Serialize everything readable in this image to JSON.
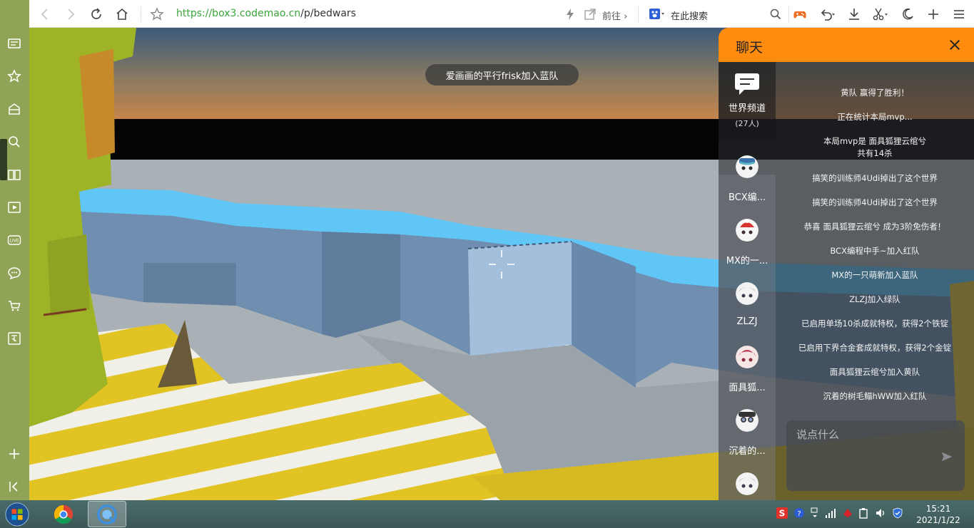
{
  "browser": {
    "url_host": "https://box3.codemao.cn",
    "url_path": "/p/bedwars",
    "goto_label": "前往",
    "search_label": "在此搜索"
  },
  "game": {
    "toast": "爱画画的平行frisk加入蓝队"
  },
  "chat": {
    "title": "聊天",
    "channels": [
      {
        "name": "世界频道",
        "count": "(27人)"
      },
      {
        "name": "BCX编..."
      },
      {
        "name": "MX的一..."
      },
      {
        "name": "ZLZJ"
      },
      {
        "name": "面具狐..."
      },
      {
        "name": "沉着的..."
      }
    ],
    "messages": [
      "黄队 赢得了胜利！",
      "正在统计本局mvp...",
      "本局mvp是 面具狐狸云绾兮",
      "共有14杀",
      "搞笑的训练师4Udi掉出了这个世界",
      "搞笑的训练师4Udi掉出了这个世界",
      "恭喜 面具狐狸云绾兮 成为3阶免伤者！",
      "BCX编程中手~加入红队",
      "MX的一只萌新加入蓝队",
      "ZLZJ加入绿队",
      "已启用单场10杀成就特权，获得2个铁锭",
      "已启用下界合金套成就特权，获得2个金锭",
      "面具狐狸云绾兮加入黄队",
      "沉着的树毛鳎hWW加入红队"
    ],
    "input_placeholder": "说点什么"
  },
  "taskbar": {
    "time": "15:21",
    "date": "2021/1/22"
  },
  "colors": {
    "chat_header": "#ff8c0f",
    "sidebar": "#8fa456",
    "water": "#5fc6f6",
    "block": "#6f8eb0",
    "sand": "#e0c228"
  }
}
